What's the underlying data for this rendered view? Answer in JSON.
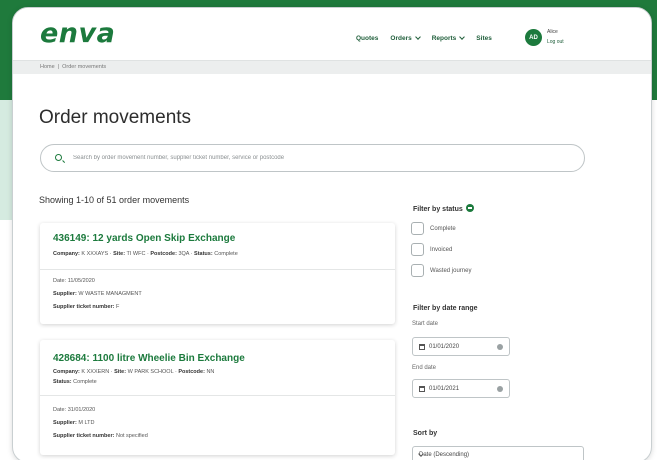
{
  "brand": {
    "logo": "enva"
  },
  "nav": {
    "items": [
      {
        "label": "Quotes",
        "has_menu": false
      },
      {
        "label": "Orders",
        "has_menu": true
      },
      {
        "label": "Reports",
        "has_menu": true
      },
      {
        "label": "Sites",
        "has_menu": false
      }
    ]
  },
  "user": {
    "initials": "AD",
    "name": "Alice",
    "logout": "Log out"
  },
  "breadcrumb": {
    "home": "Home",
    "separator": "|",
    "current": "Order movements"
  },
  "page": {
    "title": "Order movements",
    "search_placeholder": "Search by order movement number, supplier ticket number, service or postcode",
    "showing": "Showing 1-10 of 51 order movements"
  },
  "orders": [
    {
      "title": "436149: 12 yards Open Skip Exchange",
      "line1": {
        "company_label": "Company:",
        "company": "K XXXAYS",
        "site_label": "Site:",
        "site": "TI WFC",
        "postcode_label": "Postcode:",
        "postcode": "3QA",
        "status_label": "Status:",
        "status": "Complete"
      },
      "line2": null,
      "date_label": "Date:",
      "date": "11/05/2020",
      "supplier_label": "Supplier:",
      "supplier": "W WASTE MANAGMENT",
      "ticket_label": "Supplier ticket number:",
      "ticket": "F"
    },
    {
      "title": "428684: 1100 litre Wheelie Bin Exchange",
      "line1": {
        "company_label": "Company:",
        "company": "K XXXERN",
        "site_label": "Site:",
        "site": "W PARK SCHOOL",
        "postcode_label": "Postcode:",
        "postcode": "NN",
        "status_label": "",
        "status": ""
      },
      "line2": {
        "status_label": "Status:",
        "status": "Complete"
      },
      "date_label": "Date:",
      "date": "31/01/2020",
      "supplier_label": "Supplier:",
      "supplier": "M LTD",
      "ticket_label": "Supplier ticket number:",
      "ticket": "Not specified"
    }
  ],
  "filters": {
    "status_title": "Filter by status",
    "status_options": [
      "Complete",
      "Invoiced",
      "Wasted journey"
    ],
    "date_title": "Filter by date range",
    "start_label": "Start date",
    "start_value": "01/01/2020",
    "end_label": "End date",
    "end_value": "01/01/2021",
    "sort_title": "Sort by",
    "sort_value": "Date (Descending)"
  },
  "colors": {
    "brand_green": "#1c7a3d",
    "dark_green_bg": "#1f7a3c",
    "mint_bg": "#d5ebe0"
  }
}
